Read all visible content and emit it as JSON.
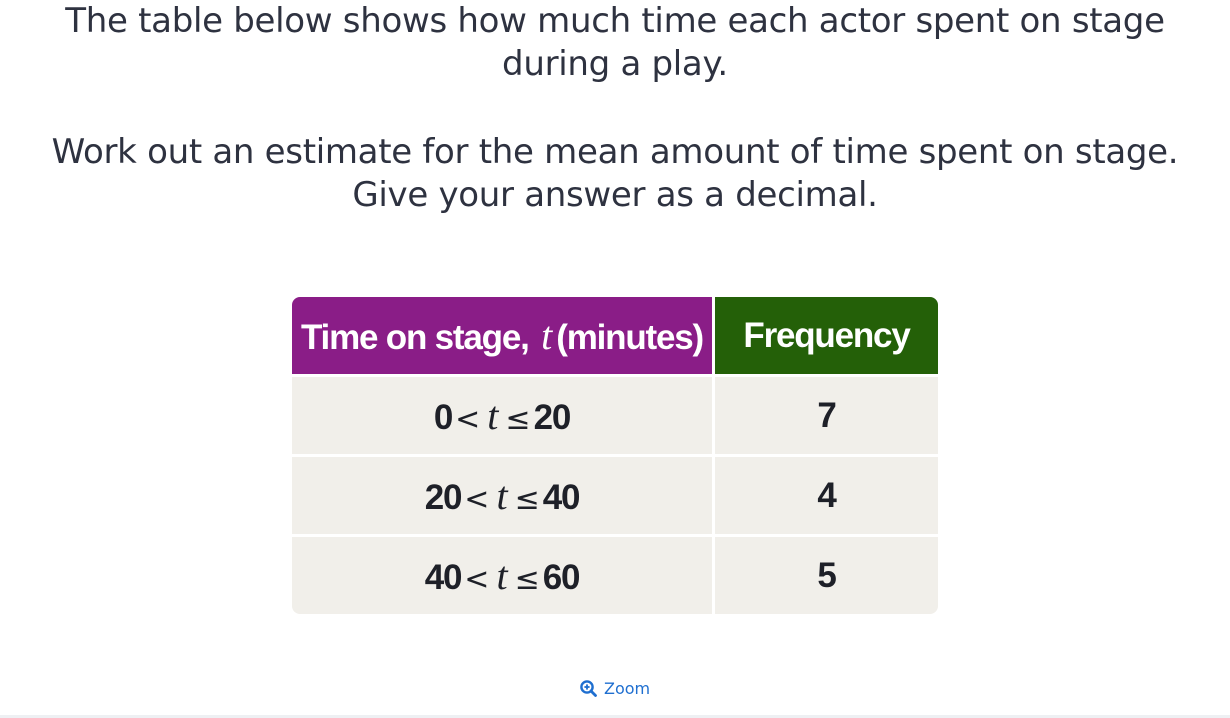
{
  "question": {
    "line1a": "The table below shows how much time each actor spent on stage",
    "line1b": "during a play.",
    "line2a": "Work out an estimate for the mean amount of time spent on stage.",
    "line2b": "Give your answer as a decimal."
  },
  "table": {
    "header_time_prefix": "Time on stage,",
    "header_time_var": "t",
    "header_time_suffix": "(minutes)",
    "header_frequency": "Frequency",
    "header_time_color": "#8a1d87",
    "header_frequency_color": "#246008",
    "rows": [
      {
        "lower": "0",
        "op1": "<",
        "var": "t",
        "op2": "≤",
        "upper": "20",
        "frequency": "7"
      },
      {
        "lower": "20",
        "op1": "<",
        "var": "t",
        "op2": "≤",
        "upper": "40",
        "frequency": "4"
      },
      {
        "lower": "40",
        "op1": "<",
        "var": "t",
        "op2": "≤",
        "upper": "60",
        "frequency": "5"
      }
    ]
  },
  "zoom": {
    "label": "Zoom",
    "icon": "zoom-in-magnifier-icon",
    "color": "#1f6fd0"
  }
}
